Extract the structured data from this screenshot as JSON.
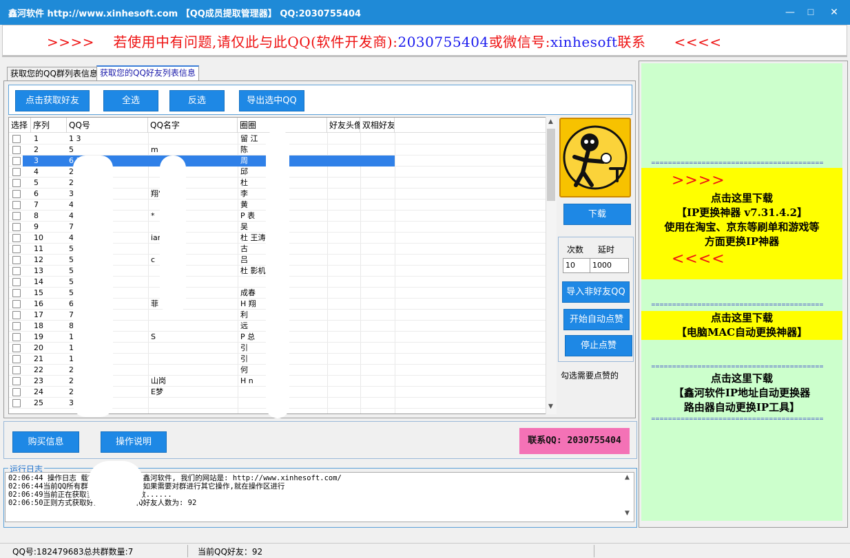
{
  "window": {
    "title": "鑫河软件 http://www.xinhesoft.com 【QQ成员提取管理器】 QQ:2030755404",
    "minimize": "—",
    "maximize": "☐",
    "close": "✕"
  },
  "banner": {
    "left_arrows": ">>>>",
    "text_before": "若使用中有问题,请仅此与此QQ(软件开发商):",
    "qq": "2030755404",
    "text_middle": "或微信号:",
    "wechat": "xinhesoft",
    "text_after": "联系",
    "right_arrows": "<<<<"
  },
  "tabs": [
    {
      "label": "获取您的QQ群列表信息"
    },
    {
      "label": "获取您的QQ好友列表信息"
    }
  ],
  "toolbar": {
    "get_friends": "点击获取好友",
    "select_all": "全选",
    "invert": "反选",
    "export": "导出选中QQ"
  },
  "grid": {
    "columns": [
      "选择",
      "序列",
      "QQ号",
      "QQ名字",
      "圈圈",
      "好友头像",
      "双相好友"
    ],
    "rows": [
      {
        "seq": "1",
        "qq": "1   3",
        "name": "",
        "circle": "留      江"
      },
      {
        "seq": "2",
        "qq": "5",
        "name": "      m",
        "circle": "陈"
      },
      {
        "seq": "3",
        "qq": "6   3",
        "name": "",
        "circle": "周"
      },
      {
        "seq": "4",
        "qq": "2   33",
        "name": "",
        "circle": "邱"
      },
      {
        "seq": "5",
        "qq": "2   36",
        "name": "",
        "circle": "杜"
      },
      {
        "seq": "6",
        "qq": "    35",
        "name": "    翔‘",
        "circle": "李"
      },
      {
        "seq": "7",
        "qq": "4   01",
        "name": "",
        "circle": "黄"
      },
      {
        "seq": "8",
        "qq": "4   31",
        "name": "    *",
        "circle": "P   表"
      },
      {
        "seq": "9",
        "qq": "    73",
        "name": "",
        "circle": "吴"
      },
      {
        "seq": "10",
        "qq": "4   79",
        "name": "    iam",
        "circle": "杜      王涛"
      },
      {
        "seq": "11",
        "qq": "5   08",
        "name": "",
        "circle": "古"
      },
      {
        "seq": "12",
        "qq": "5   36",
        "name": "c",
        "circle": "吕"
      },
      {
        "seq": "13",
        "qq": "5",
        "name": "",
        "circle": "杜      影机"
      },
      {
        "seq": "14",
        "qq": "5",
        "name": "",
        "circle": ""
      },
      {
        "seq": "15",
        "qq": "5",
        "name": "",
        "circle": "      成春"
      },
      {
        "seq": "16",
        "qq": "6",
        "name": "    菲",
        "circle": "H     翔"
      },
      {
        "seq": "17",
        "qq": "7",
        "name": "",
        "circle": "利"
      },
      {
        "seq": "18",
        "qq": "8",
        "name": "",
        "circle": "      远"
      },
      {
        "seq": "19",
        "qq": "1   2",
        "name": "S",
        "circle": "P     总"
      },
      {
        "seq": "20",
        "qq": "1   5",
        "name": "",
        "circle": "引"
      },
      {
        "seq": "21",
        "qq": "1   4",
        "name": "",
        "circle": "引"
      },
      {
        "seq": "22",
        "qq": "2   4",
        "name": "",
        "circle": "何"
      },
      {
        "seq": "23",
        "qq": "2   74",
        "name": "    山岗",
        "circle": "H     n"
      },
      {
        "seq": "24",
        "qq": "2   11",
        "name": "    E梦",
        "circle": ""
      },
      {
        "seq": "25",
        "qq": "    35",
        "name": "",
        "circle": ""
      }
    ]
  },
  "side": {
    "download": "下载",
    "count_label": "次数",
    "delay_label": "延时",
    "count_value": "10",
    "delay_value": "1000",
    "import_non_friend": "导入非好友QQ",
    "start_like": "开始自动点赞",
    "stop_like": "停止点赞",
    "hint": "勾选需要点赞的"
  },
  "bottom": {
    "buy": "购买信息",
    "manual": "操作说明",
    "contact": "联系QQ: 2030755404"
  },
  "log": {
    "title": "运行日志",
    "lines": [
      "02:06:44 操作日志               载完成,欢迎你使用鑫河软件, 我们的网站是: http://www.xinhesoft.com/",
      "02:06:44当前QQ所有群           可获取群人员。如果需要对群进行其它操作,就在操作区进行",
      "02:06:49当前正在获取当前Q        的好友人数......",
      "02:06:50正则方式获取好友完成,当前QQ好友人数为: 92"
    ]
  },
  "ads": {
    "separator": "=========================================",
    "ad1": {
      "top_arrows": ">>>>",
      "line1": "点击这里下载",
      "line2": "【IP更换神器 v7.31.4.2】",
      "line3": "使用在淘宝、京东等刷单和游戏等",
      "line4": "方面更换IP神器",
      "bottom_arrows": "<<<<"
    },
    "ad2": {
      "line1": "点击这里下载",
      "line2": "【电脑MAC自动更换神器】"
    },
    "ad3": {
      "line1": "点击这里下载",
      "line2": "【鑫河软件IP地址自动更换器",
      "line3": "路由器自动更换IP工具】"
    },
    "colors": {
      "ad_bg": "#ffff00",
      "panel_bg": "#ccffcc",
      "arrows": "#ee1111"
    }
  },
  "status": {
    "account": "QQ号:182479683总共群数量:7",
    "friends": "当前QQ好友：92"
  },
  "colors": {
    "titlebar": "#1f8ad7",
    "button": "#1e88e5",
    "contact_bg": "#f472b6",
    "selected_row": "#2f80e8"
  }
}
